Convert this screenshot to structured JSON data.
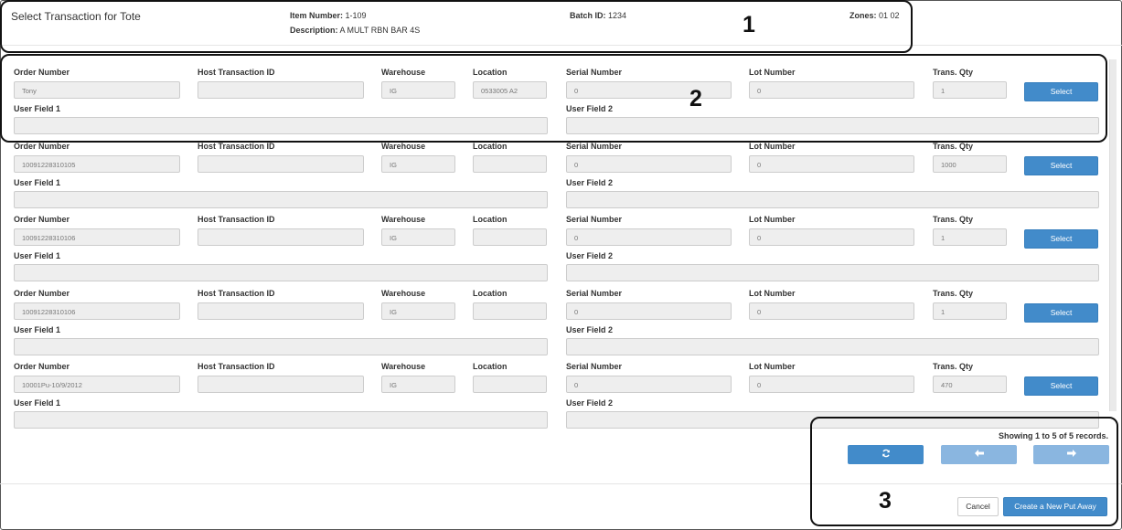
{
  "header": {
    "title": "Select Transaction for Tote",
    "item_number_label": "Item Number:",
    "item_number": "1-109",
    "description_label": "Description:",
    "description": "A MULT RBN BAR 4S",
    "batch_label": "Batch ID:",
    "batch_id": "1234",
    "zones_label": "Zones:",
    "zones": "01 02"
  },
  "labels": {
    "order_number": "Order Number",
    "host_transaction_id": "Host Transaction ID",
    "warehouse": "Warehouse",
    "location": "Location",
    "serial_number": "Serial Number",
    "lot_number": "Lot Number",
    "trans_qty": "Trans. Qty",
    "user_field_1": "User Field 1",
    "user_field_2": "User Field 2",
    "select": "Select"
  },
  "records": [
    {
      "order_number": "Tony",
      "host_transaction_id": "",
      "warehouse": "IG",
      "location": "0533005 A2",
      "serial_number": "0",
      "lot_number": "0",
      "trans_qty": "1",
      "user_field_1": "",
      "user_field_2": ""
    },
    {
      "order_number": "10091228310105",
      "host_transaction_id": "",
      "warehouse": "IG",
      "location": "",
      "serial_number": "0",
      "lot_number": "0",
      "trans_qty": "1000",
      "user_field_1": "",
      "user_field_2": ""
    },
    {
      "order_number": "10091228310106",
      "host_transaction_id": "",
      "warehouse": "IG",
      "location": "",
      "serial_number": "0",
      "lot_number": "0",
      "trans_qty": "1",
      "user_field_1": "",
      "user_field_2": ""
    },
    {
      "order_number": "10091228310106",
      "host_transaction_id": "",
      "warehouse": "IG",
      "location": "",
      "serial_number": "0",
      "lot_number": "0",
      "trans_qty": "1",
      "user_field_1": "",
      "user_field_2": ""
    },
    {
      "order_number": "10001Pu-10/9/2012",
      "host_transaction_id": "",
      "warehouse": "IG",
      "location": "",
      "serial_number": "0",
      "lot_number": "0",
      "trans_qty": "470",
      "user_field_1": "",
      "user_field_2": ""
    }
  ],
  "pagination": {
    "showing_text": "Showing 1 to 5 of 5 records.",
    "refresh_icon": "refresh-icon",
    "prev_icon": "arrow-left-icon",
    "next_icon": "arrow-right-icon"
  },
  "footer": {
    "cancel_label": "Cancel",
    "new_put_away_label": "Create a New Put Away"
  },
  "annotations": [
    "1",
    "2",
    "3"
  ],
  "colors": {
    "primary": "#428bca",
    "primary_disabled": "#8ab6e0",
    "field_bg": "#eeeeee"
  }
}
